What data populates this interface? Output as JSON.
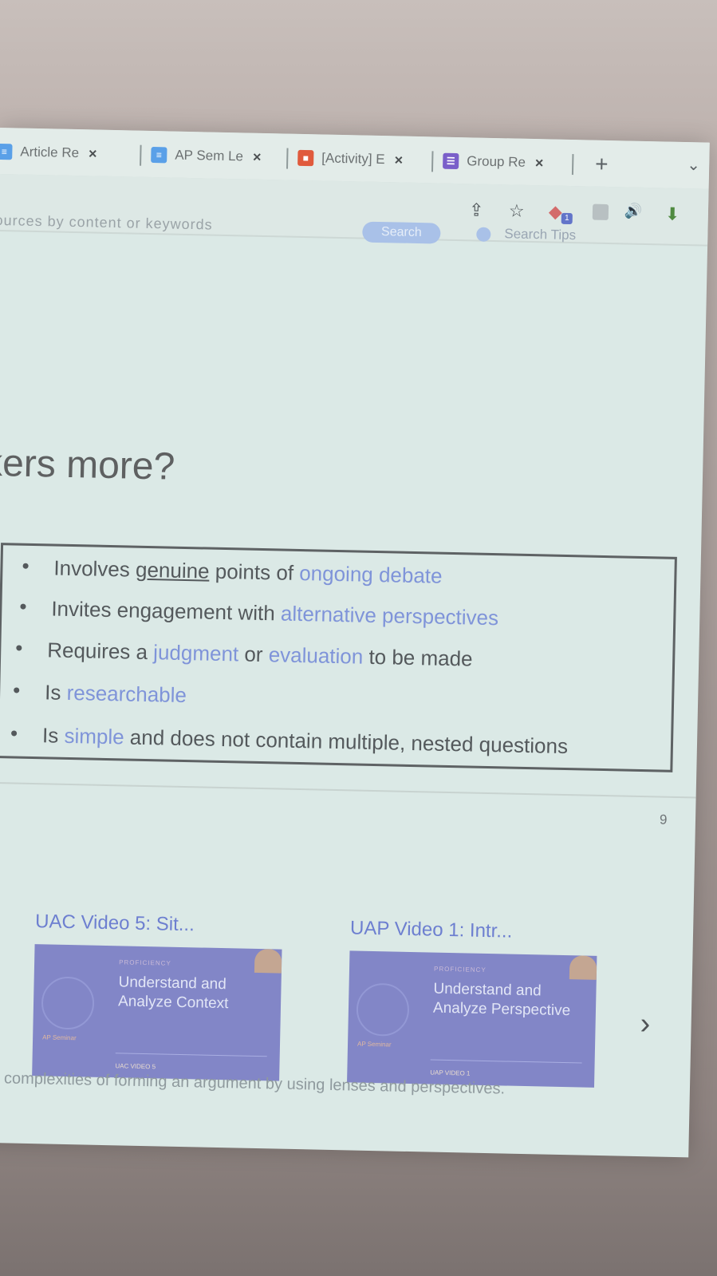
{
  "tabs": [
    {
      "label": "Article Re",
      "color": "#5aa0e8",
      "glyph": "≡"
    },
    {
      "label": "AP Sem Le",
      "color": "#5aa0e8",
      "glyph": "≡"
    },
    {
      "label": "[Activity] E",
      "color": "#e05a3c",
      "glyph": "■"
    },
    {
      "label": "Group Re",
      "color": "#7a5fc9",
      "glyph": "☰"
    }
  ],
  "tab_close": "×",
  "new_tab": "+",
  "tab_chevron": "⌄",
  "search": {
    "placeholder": "ources by content or keywords",
    "button": "Search",
    "tips": "Search Tips"
  },
  "toolbar_icons": {
    "share": "⇪",
    "star": "☆",
    "speaker": "🔊",
    "download": "⬇"
  },
  "slide": {
    "heading": "kers more?",
    "criteria": [
      {
        "parts": [
          {
            "t": "Involves ",
            "s": ""
          },
          {
            "t": "genuine",
            "s": "ul"
          },
          {
            "t": " points of ",
            "s": ""
          },
          {
            "t": "ongoing debate",
            "s": "hl"
          }
        ]
      },
      {
        "parts": [
          {
            "t": "Invites engagement with ",
            "s": ""
          },
          {
            "t": "alternative perspectives",
            "s": "hl"
          }
        ]
      },
      {
        "parts": [
          {
            "t": "Requires a ",
            "s": ""
          },
          {
            "t": "judgment",
            "s": "hl"
          },
          {
            "t": " or ",
            "s": ""
          },
          {
            "t": "evaluation",
            "s": "hl"
          },
          {
            "t": " to be made",
            "s": ""
          }
        ]
      },
      {
        "parts": [
          {
            "t": "Is ",
            "s": ""
          },
          {
            "t": "researchable",
            "s": "hl"
          }
        ]
      },
      {
        "parts": [
          {
            "t": "Is ",
            "s": ""
          },
          {
            "t": "simple",
            "s": "hl"
          },
          {
            "t": " and does not contain multiple, nested questions",
            "s": ""
          }
        ]
      }
    ],
    "bullet": "•",
    "page_number": "9"
  },
  "videos": [
    {
      "title": "UAC Video 5: Sit...",
      "proficiency": "PROFICIENCY",
      "line1": "Understand and",
      "line2": "Analyze Context",
      "brand": "AP Seminar",
      "label": "UAC VIDEO 5"
    },
    {
      "title": "UAP Video 1: Intr...",
      "proficiency": "PROFICIENCY",
      "line1": "Understand and",
      "line2": "Analyze Perspective",
      "brand": "AP Seminar",
      "label": "UAP VIDEO 1"
    }
  ],
  "next_arrow": "›",
  "bottom_text": "complexities of forming an argument by using lenses and perspectives."
}
